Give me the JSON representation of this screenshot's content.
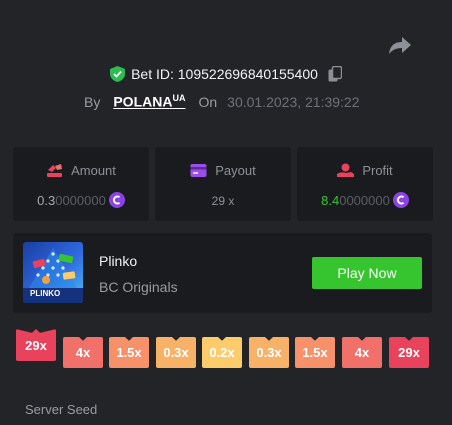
{
  "header": {
    "bet_id_label": "Bet ID: 109522696840155400",
    "by_label": "By",
    "username": "POLANA",
    "username_suffix": "UA",
    "on_label": "On",
    "datetime": "30.01.2023, 21:39:22"
  },
  "stats": {
    "amount": {
      "label": "Amount",
      "value_lead": "0.3",
      "value_tail": "0000000"
    },
    "payout": {
      "label": "Payout",
      "value": "29 x"
    },
    "profit": {
      "label": "Profit",
      "value_lead": "8.4",
      "value_tail": "0000000"
    }
  },
  "game": {
    "name": "Plinko",
    "provider": "BC Originals",
    "thumb_text": "PLINKO",
    "play_label": "Play Now"
  },
  "multipliers": [
    "29x",
    "4x",
    "1.5x",
    "0.3x",
    "0.2x",
    "0.3x",
    "1.5x",
    "4x",
    "29x"
  ],
  "multiplier_colors": [
    "#e8425c",
    "#f2706a",
    "#f6916a",
    "#f7b267",
    "#fccc6a",
    "#f7b267",
    "#f6916a",
    "#f2706a",
    "#e8425c"
  ],
  "selected_multiplier_index": 0,
  "seed": {
    "label": "Server Seed"
  },
  "colors": {
    "accent_green": "#37c52f",
    "coin_purple": "#8b43e6",
    "shield_green": "#2dbb52"
  }
}
